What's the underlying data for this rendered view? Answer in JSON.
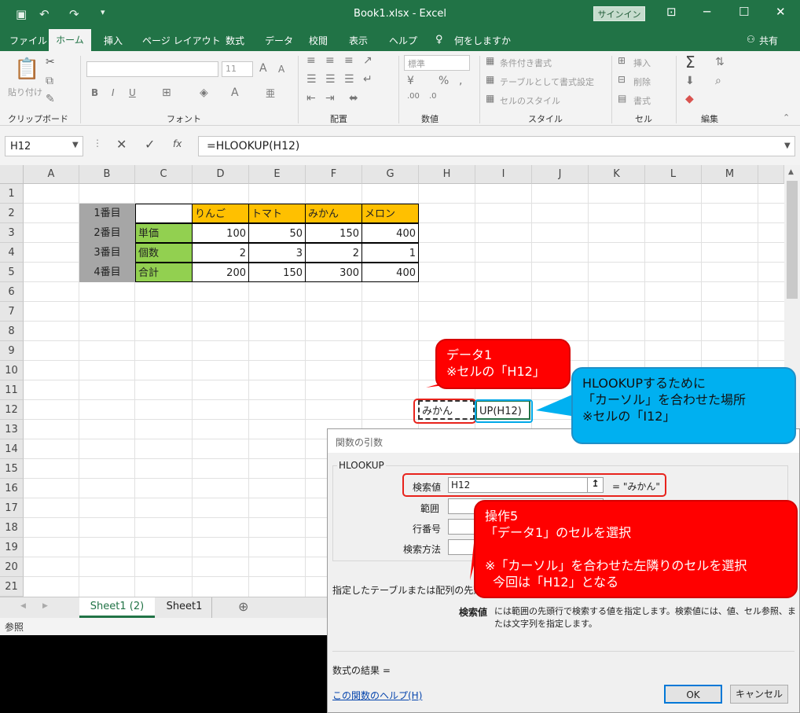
{
  "window": {
    "title": "Book1.xlsx  -  Excel",
    "signin": "サインイン"
  },
  "menu": [
    "ファイル",
    "ホーム",
    "挿入",
    "ページ レイアウト",
    "数式",
    "データ",
    "校閲",
    "表示",
    "ヘルプ",
    "何をしますか",
    "共有"
  ],
  "ribbon": {
    "paste": "貼り付け",
    "groups": [
      "クリップボード",
      "フォント",
      "配置",
      "数値",
      "スタイル",
      "セル",
      "編集"
    ],
    "font_size": "11",
    "number_format": "標準",
    "styles": [
      "条件付き書式",
      "テーブルとして書式設定",
      "セルのスタイル"
    ],
    "cells": [
      "挿入",
      "削除",
      "書式"
    ]
  },
  "formula_bar": {
    "name_box": "H12",
    "formula": "=HLOOKUP(H12)",
    "fx": "fx"
  },
  "columns": [
    "A",
    "B",
    "C",
    "D",
    "E",
    "F",
    "G",
    "H",
    "I",
    "J",
    "K",
    "L",
    "M"
  ],
  "rows": [
    "1",
    "2",
    "3",
    "4",
    "5",
    "6",
    "7",
    "8",
    "9",
    "10",
    "11",
    "12",
    "13",
    "14",
    "15",
    "16",
    "17",
    "18",
    "19",
    "20",
    "21"
  ],
  "table": {
    "row_labels": [
      "1番目",
      "2番目",
      "3番目",
      "4番目"
    ],
    "headers": [
      "りんご",
      "トマト",
      "みかん",
      "メロン"
    ],
    "items": [
      "単価",
      "個数",
      "合計"
    ],
    "values": [
      [
        "100",
        "50",
        "150",
        "400"
      ],
      [
        "2",
        "3",
        "2",
        "1"
      ],
      [
        "200",
        "150",
        "300",
        "400"
      ]
    ]
  },
  "cells": {
    "h12": "みかん",
    "i12": "UP(H12)"
  },
  "sheets": [
    "Sheet1 (2)",
    "Sheet1"
  ],
  "status": "参照",
  "dialog": {
    "title": "関数の引数",
    "function": "HLOOKUP",
    "args": [
      "検索値",
      "範囲",
      "行番号",
      "検索方法"
    ],
    "arg1_value": "H12",
    "arg1_result": "=  \"みかん\"",
    "desc": "指定したテーブルまたは配列の先頭行で",
    "arg_desc_label": "検索値",
    "arg_desc": "には範囲の先頭行で検索する値を指定します。検索値には、値、セル参照、ま\nたは文字列を指定します。",
    "result_label": "数式の結果 =",
    "help": "この関数のヘルプ(H)",
    "ok": "OK",
    "cancel": "キャンセル"
  },
  "callouts": {
    "data1": "データ1\n※セルの「H12」",
    "cursor": "HLOOKUPするために\n「カーソル」を合わせた場所\n※セルの「I12」",
    "op5": "操作5\n「データ1」のセルを選択\n\n※「カーソル」を合わせた左隣りのセルを選択\n  今回は「H12」となる"
  },
  "colors": {
    "excel_green": "#217346",
    "orange": "#ffc000",
    "green": "#92d050",
    "gray": "#a6a6a6",
    "callout_red": "#ff0000",
    "callout_blue": "#00b0f0"
  }
}
